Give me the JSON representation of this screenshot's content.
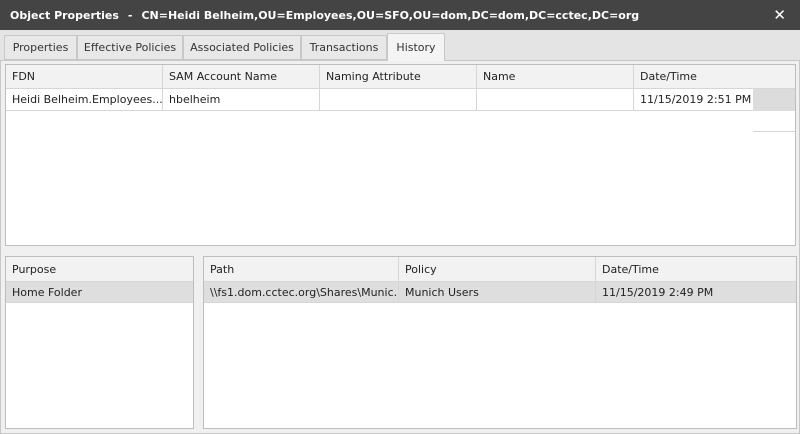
{
  "window": {
    "title": "Object Properties",
    "separator": "-",
    "object_dn": "CN=Heidi Belheim,OU=Employees,OU=SFO,OU=dom,DC=dom,DC=cctec,DC=org",
    "close": "✕"
  },
  "tabs": [
    {
      "label": "Properties"
    },
    {
      "label": "Effective Policies"
    },
    {
      "label": "Associated Policies"
    },
    {
      "label": "Transactions"
    },
    {
      "label": "History",
      "active": true
    }
  ],
  "history_table": {
    "columns": [
      "FDN",
      "SAM Account Name",
      "Naming Attribute",
      "Name",
      "Date/Time"
    ],
    "rows": [
      {
        "fdn": "Heidi Belheim.Employees....",
        "sam": "hbelheim",
        "naming": "",
        "name": "",
        "datetime": "11/15/2019 2:51 PM"
      }
    ]
  },
  "purpose_table": {
    "columns": [
      "Purpose"
    ],
    "rows": [
      {
        "purpose": "Home Folder"
      }
    ]
  },
  "detail_table": {
    "columns": [
      "Path",
      "Policy",
      "Date/Time"
    ],
    "rows": [
      {
        "path": "\\\\fs1.dom.cctec.org\\Shares\\Munic...",
        "policy": "Munich Users",
        "datetime": "11/15/2019 2:49 PM"
      }
    ]
  }
}
